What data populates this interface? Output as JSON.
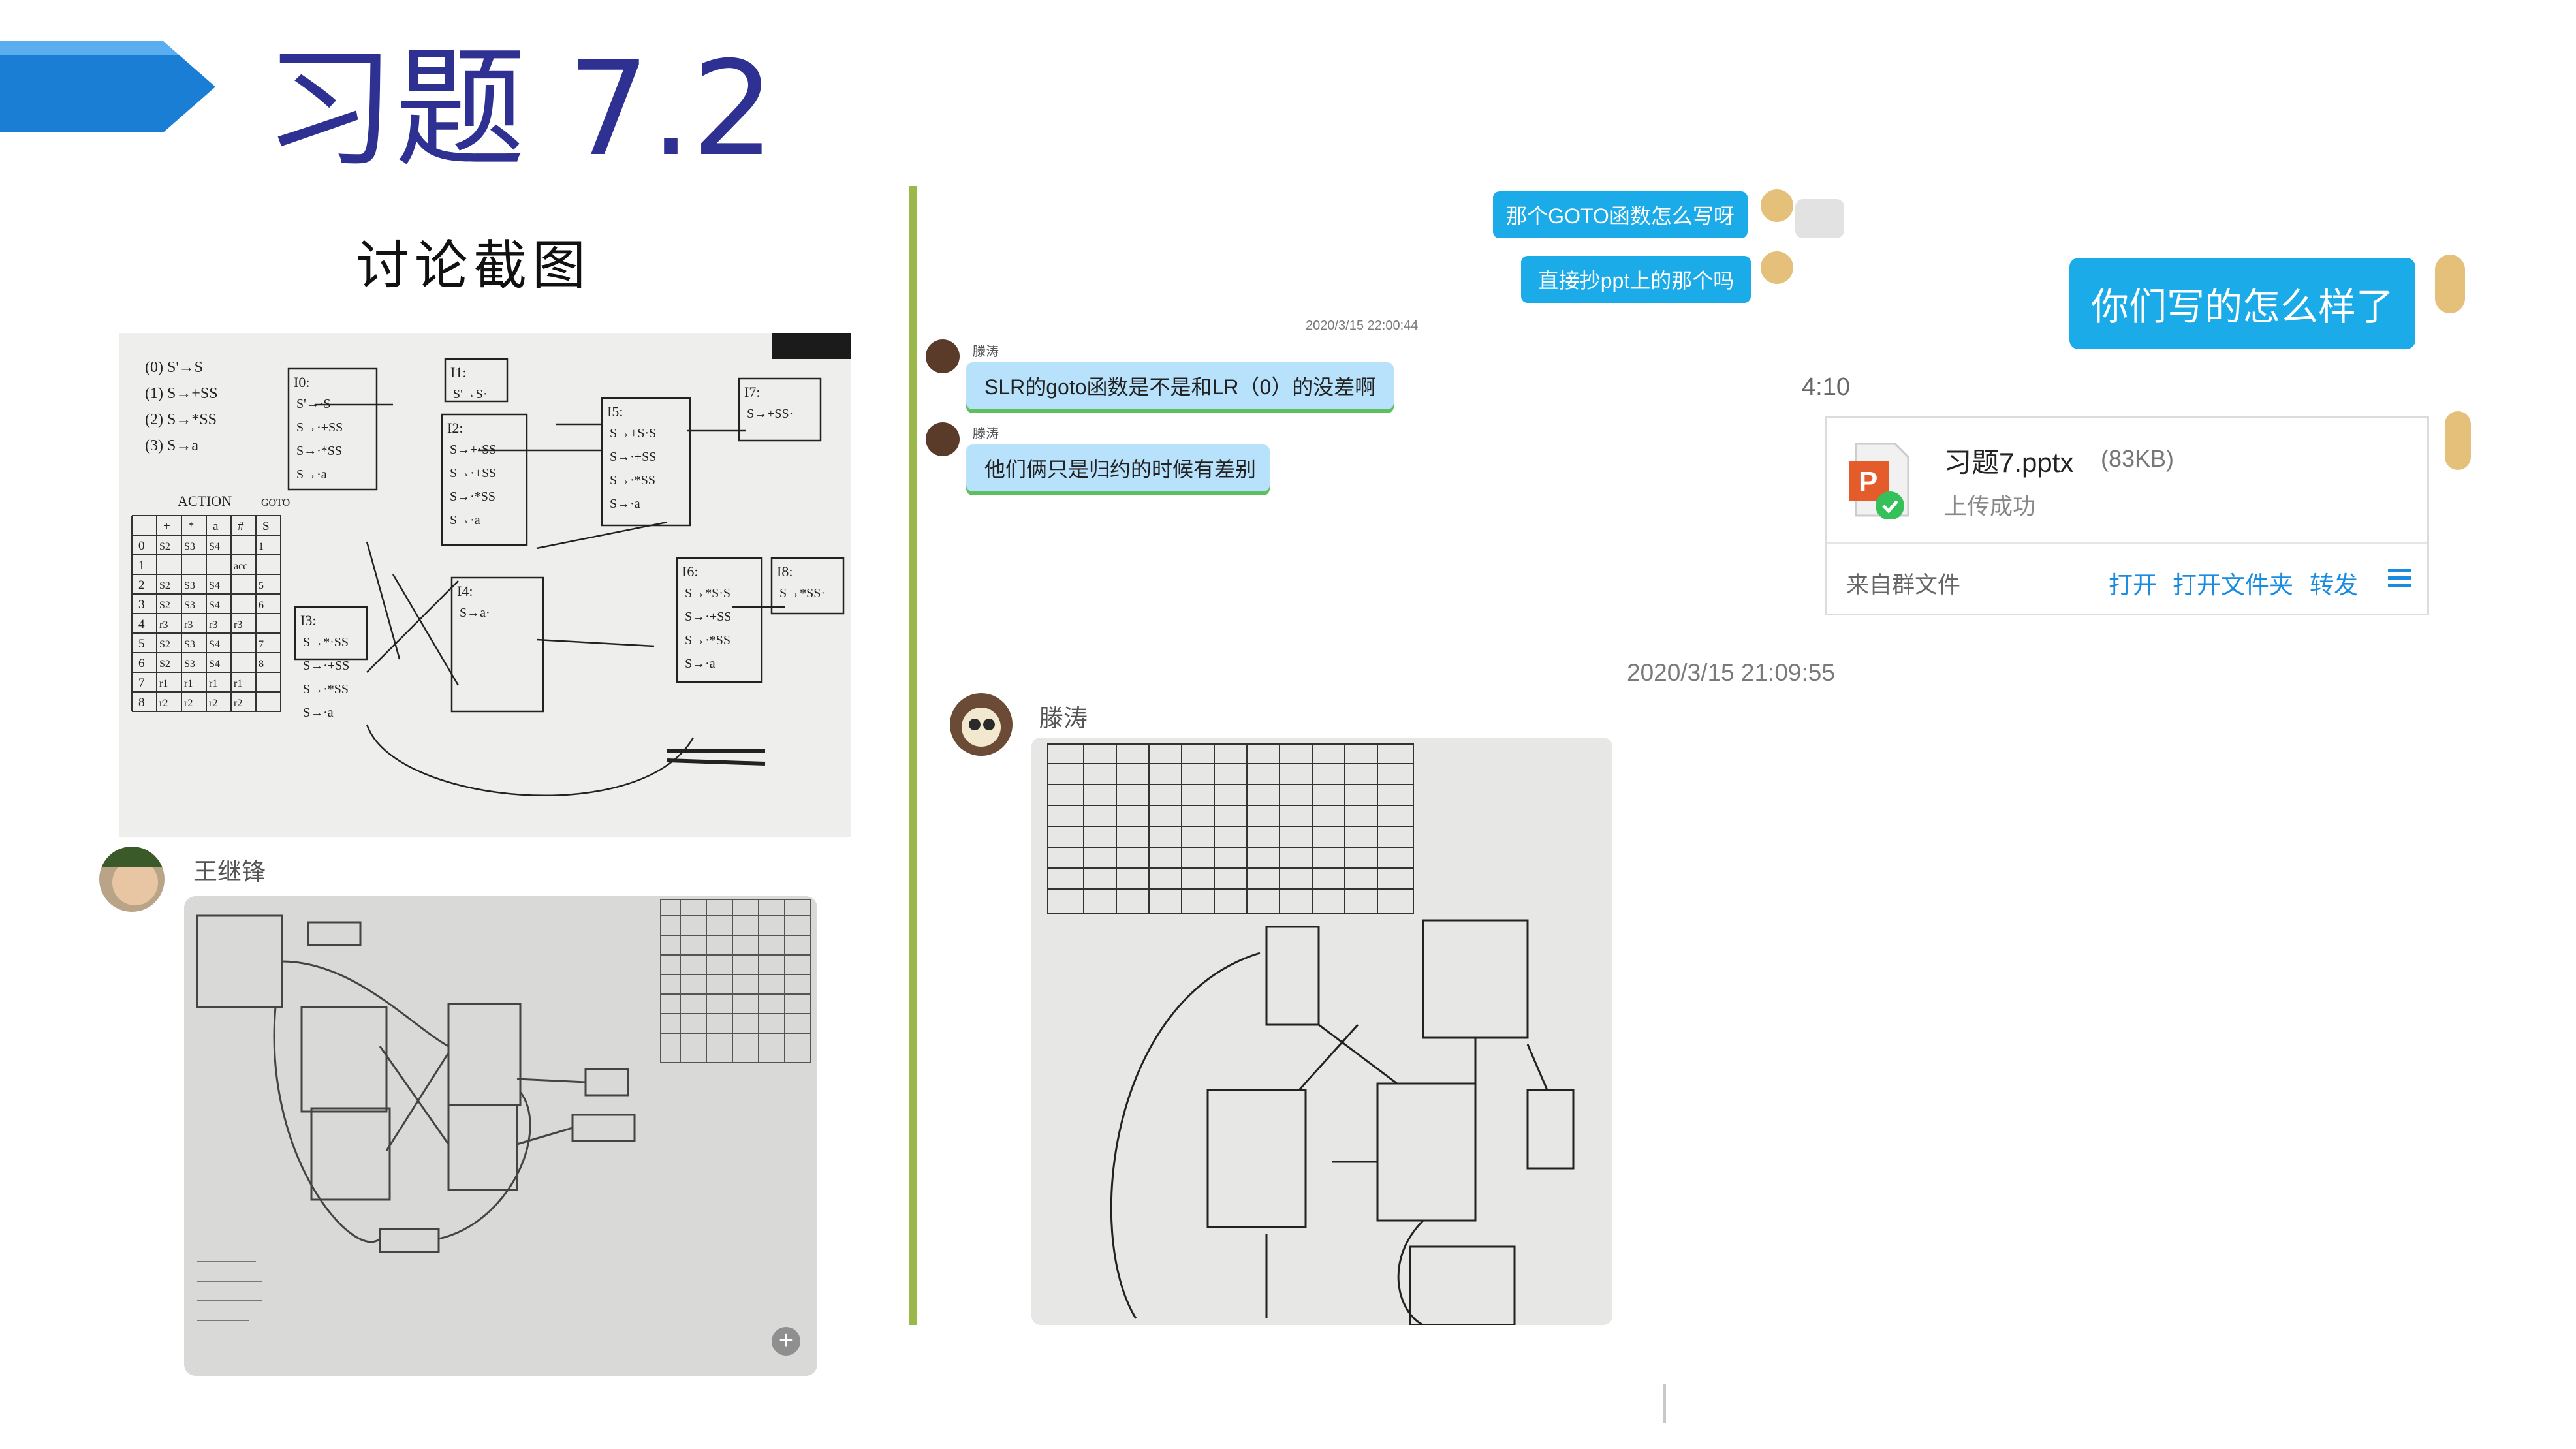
{
  "slide": {
    "title": "习题 7.2",
    "subtitle": "讨论截图",
    "accent_color": "#1a7fd4",
    "title_color": "#2e3192",
    "divider_color": "#9bb84a"
  },
  "chat_left": {
    "sender_name": "王继锋",
    "zoom_icon": "plus-magnifier-icon"
  },
  "chat_right": {
    "messages_right": [
      {
        "text": "那个GOTO函数怎么写呀"
      },
      {
        "text": "直接抄ppt上的那个吗"
      }
    ],
    "big_bubble": "你们写的怎么样了",
    "timestamp1": "2020/3/15 22:00:44",
    "timestamp_time": "4:10",
    "messages_left": [
      {
        "sender": "滕涛",
        "text": "SLR的goto函数是不是和LR（0）的没差啊"
      },
      {
        "sender": "滕涛",
        "text": "他们俩只是归约的时候有差别"
      }
    ],
    "file_card": {
      "file_name": "习题7.pptx",
      "file_size": "(83KB)",
      "status": "上传成功",
      "source": "来自群文件",
      "open_label": "打开",
      "open_folder_label": "打开文件夹",
      "forward_label": "转发",
      "menu_icon": "hamburger-icon",
      "file_icon": "ppt-file-icon"
    },
    "timestamp2": "2020/3/15 21:09:55",
    "sender_photo": "滕涛"
  },
  "photo1": {
    "grammar": [
      "(0) S'→S",
      "(1) S→+SS",
      "(2) S→*SS",
      "(3) S→a"
    ],
    "table_header": "ACTION",
    "goto_header": "GOTO",
    "col_headers": [
      "+",
      "*",
      "a",
      "#",
      "S"
    ],
    "rows": [
      {
        "state": "0",
        "cells": [
          "S2",
          "S3",
          "S4",
          "",
          "1"
        ]
      },
      {
        "state": "1",
        "cells": [
          "",
          "",
          "",
          "acc",
          ""
        ]
      },
      {
        "state": "2",
        "cells": [
          "S2",
          "S3",
          "S4",
          "",
          "5"
        ]
      },
      {
        "state": "3",
        "cells": [
          "S2",
          "S3",
          "S4",
          "",
          "6"
        ]
      },
      {
        "state": "4",
        "cells": [
          "r3",
          "r3",
          "r3",
          "r3",
          ""
        ]
      },
      {
        "state": "5",
        "cells": [
          "S2",
          "S3",
          "S4",
          "",
          "7"
        ]
      },
      {
        "state": "6",
        "cells": [
          "S2",
          "S3",
          "S4",
          "",
          "8"
        ]
      },
      {
        "state": "7",
        "cells": [
          "r1",
          "r1",
          "r1",
          "r1",
          ""
        ]
      },
      {
        "state": "8",
        "cells": [
          "r2",
          "r2",
          "r2",
          "r2",
          ""
        ]
      }
    ],
    "states": [
      {
        "label": "I0:",
        "items": [
          "S'→·S",
          "S→·+SS",
          "S→·*SS",
          "S→·a"
        ]
      },
      {
        "label": "I1:",
        "items": [
          "S'→S·"
        ]
      },
      {
        "label": "I2:",
        "items": [
          "S→+·SS",
          "S→·+SS",
          "S→·*SS",
          "S→·a"
        ]
      },
      {
        "label": "I3:",
        "items": [
          "S→*·SS",
          "S→·+SS",
          "S→·*SS",
          "S→·a"
        ]
      },
      {
        "label": "I4:",
        "items": [
          "S→a·"
        ]
      },
      {
        "label": "I5:",
        "items": [
          "S→+S·S",
          "S→·+SS",
          "S→·*SS",
          "S→·a"
        ]
      },
      {
        "label": "I6:",
        "items": [
          "S→*S·S",
          "S→·+SS",
          "S→·*SS",
          "S→·a"
        ]
      },
      {
        "label": "I7:",
        "items": [
          "S→+SS·"
        ]
      },
      {
        "label": "I8:",
        "items": [
          "S→*SS·"
        ]
      }
    ]
  }
}
